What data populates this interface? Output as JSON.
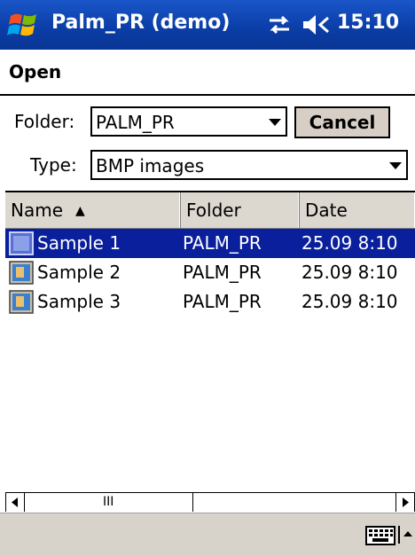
{
  "titlebar": {
    "app_title": "Palm_PR (demo)",
    "time": "15:10",
    "icons": [
      "windows-start-icon",
      "connectivity-icon",
      "speaker-icon"
    ]
  },
  "header": {
    "title": "Open"
  },
  "form": {
    "folder_label": "Folder:",
    "folder_value": "PALM_PR",
    "type_label": "Type:",
    "type_value": "BMP images",
    "cancel_label": "Cancel"
  },
  "list": {
    "columns": [
      "Name",
      "Folder",
      "Date"
    ],
    "sort_indicator": "▲",
    "rows": [
      {
        "name": "Sample 1",
        "folder": "PALM_PR",
        "date": "25.09 8:10",
        "selected": true
      },
      {
        "name": "Sample 2",
        "folder": "PALM_PR",
        "date": "25.09 8:10",
        "selected": false
      },
      {
        "name": "Sample 3",
        "folder": "PALM_PR",
        "date": "25.09 8:10",
        "selected": false
      }
    ]
  },
  "scrollbar": {
    "thumb_grip": "III"
  },
  "colors": {
    "titlebar": "#0b3ea8",
    "selection": "#0a1f9c",
    "button_face": "#d7cfc6",
    "header_face": "#dcd7cf",
    "bottombar": "#d8d3ca"
  }
}
